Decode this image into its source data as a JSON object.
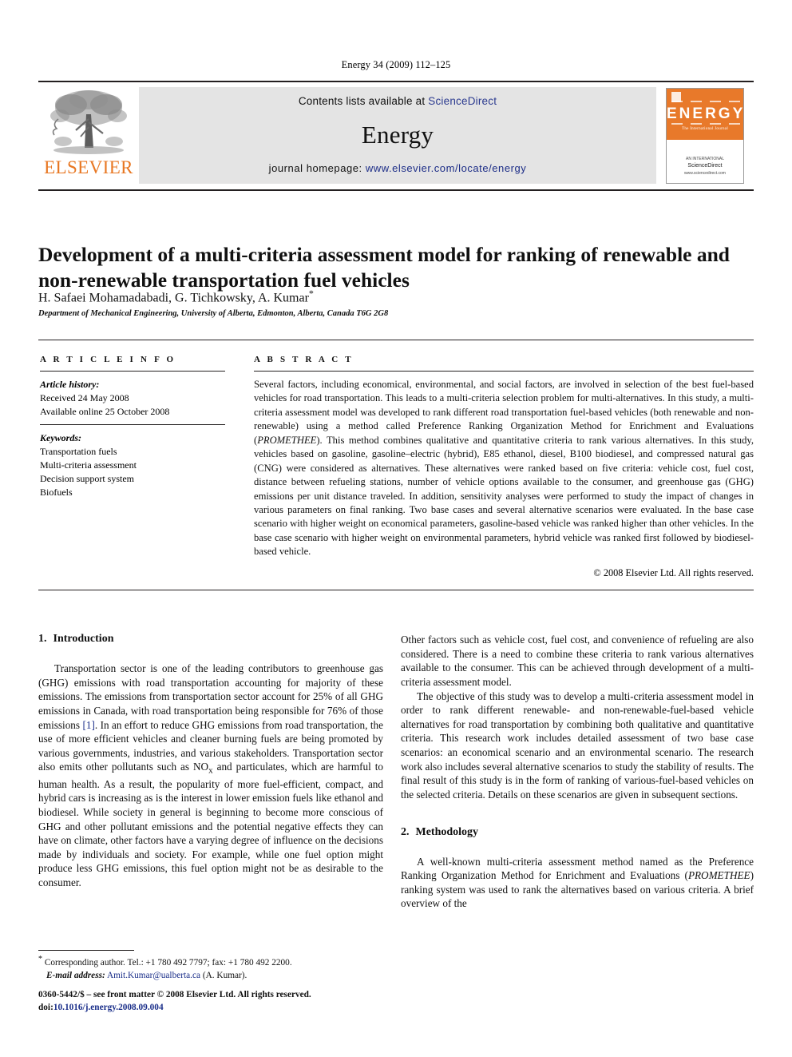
{
  "running_head": "Energy 34 (2009) 112–125",
  "masthead": {
    "publisher_name": "ELSEVIER",
    "contents_prefix": "Contents lists available at ",
    "contents_link": "ScienceDirect",
    "journal_name": "Energy",
    "homepage_prefix": "journal homepage: ",
    "homepage_url": "www.elsevier.com/locate/energy",
    "cover": {
      "title": "ENERGY",
      "subtitle": "The International Journal",
      "footer_small": "AN INTERNATIONAL",
      "footer_big": "ScienceDirect",
      "footer_tiny": "www.sciencedirect.com",
      "accent_color": "#e8792a"
    }
  },
  "article": {
    "title": "Development of a multi-criteria assessment model for ranking of renewable and non-renewable transportation fuel vehicles",
    "authors": "H. Safaei Mohamadabadi, G. Tichkowsky, A. Kumar",
    "corresponding_marker": "*",
    "affiliation": "Department of Mechanical Engineering, University of Alberta, Edmonton, Alberta, Canada T6G 2G8"
  },
  "article_info": {
    "heading": "A R T I C L E  I N F O",
    "history_label": "Article history:",
    "history_lines": [
      "Received 24 May 2008",
      "Available online 25 October 2008"
    ],
    "keywords_label": "Keywords:",
    "keywords": [
      "Transportation fuels",
      "Multi-criteria assessment",
      "Decision support system",
      "Biofuels"
    ]
  },
  "abstract": {
    "heading": "A B S T R A C T",
    "body": "Several factors, including economical, environmental, and social factors, are involved in selection of the best fuel-based vehicles for road transportation. This leads to a multi-criteria selection problem for multi-alternatives. In this study, a multi-criteria assessment model was developed to rank different road transportation fuel-based vehicles (both renewable and non-renewable) using a method called Preference Ranking Organization Method for Enrichment and Evaluations (PROMETHEE). This method combines qualitative and quantitative criteria to rank various alternatives. In this study, vehicles based on gasoline, gasoline–electric (hybrid), E85 ethanol, diesel, B100 biodiesel, and compressed natural gas (CNG) were considered as alternatives. These alternatives were ranked based on five criteria: vehicle cost, fuel cost, distance between refueling stations, number of vehicle options available to the consumer, and greenhouse gas (GHG) emissions per unit distance traveled. In addition, sensitivity analyses were performed to study the impact of changes in various parameters on final ranking. Two base cases and several alternative scenarios were evaluated. In the base case scenario with higher weight on economical parameters, gasoline-based vehicle was ranked higher than other vehicles. In the base case scenario with higher weight on environmental parameters, hybrid vehicle was ranked first followed by biodiesel-based vehicle.",
    "copyright": "© 2008 Elsevier Ltd. All rights reserved."
  },
  "sections": {
    "introduction": {
      "number": "1.",
      "title": "Introduction",
      "paragraph_1": "Transportation sector is one of the leading contributors to greenhouse gas (GHG) emissions with road transportation accounting for majority of these emissions. The emissions from transportation sector account for 25% of all GHG emissions in Canada, with road transportation being responsible for 76% of those emissions [1]. In an effort to reduce GHG emissions from road transportation, the use of more efficient vehicles and cleaner burning fuels are being promoted by various governments, industries, and various stakeholders. Transportation sector also emits other pollutants such as NOx and particulates, which are harmful to human health. As a result, the popularity of more fuel-efficient, compact, and hybrid cars is increasing as is the interest in lower emission fuels like ethanol and biodiesel. While society in general is beginning to become more conscious of GHG and other pollutant emissions and the potential negative effects they can have on climate, other factors have a varying degree of influence on the decisions made by individuals and society. For example, while one fuel option might produce less GHG emissions, this fuel option might not be as desirable to the consumer.",
      "citation_1": "[1]",
      "paragraph_2": "Other factors such as vehicle cost, fuel cost, and convenience of refueling are also considered. There is a need to combine these criteria to rank various alternatives available to the consumer. This can be achieved through development of a multi-criteria assessment model.",
      "paragraph_3": "The objective of this study was to develop a multi-criteria assessment model in order to rank different renewable- and non-renewable-fuel-based vehicle alternatives for road transportation by combining both qualitative and quantitative criteria. This research work includes detailed assessment of two base case scenarios: an economical scenario and an environmental scenario. The research work also includes several alternative scenarios to study the stability of results. The final result of this study is in the form of ranking of various-fuel-based vehicles on the selected criteria. Details on these scenarios are given in subsequent sections."
    },
    "methodology": {
      "number": "2.",
      "title": "Methodology",
      "paragraph_1": "A well-known multi-criteria assessment method named as the Preference Ranking Organization Method for Enrichment and Evaluations (PROMETHEE) ranking system was used to rank the alternatives based on various criteria. A brief overview of the"
    }
  },
  "footnotes": {
    "corresponding": "Corresponding author. Tel.: +1 780 492 7797; fax: +1 780 492 2200.",
    "email_label": "E-mail address:",
    "email": "Amit.Kumar@ualberta.ca",
    "email_owner": "(A. Kumar).",
    "issn_line": "0360-5442/$ – see front matter © 2008 Elsevier Ltd. All rights reserved.",
    "doi_label": "doi:",
    "doi": "10.1016/j.energy.2008.09.004"
  }
}
